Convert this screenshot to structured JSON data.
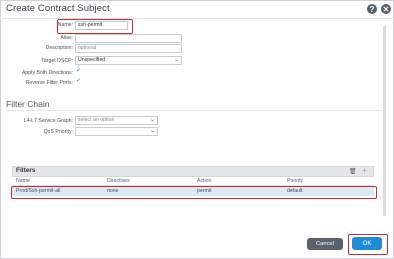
{
  "dialog": {
    "title": "Create Contract Subject",
    "help_icon": "help-icon",
    "close_icon": "close-icon"
  },
  "form": {
    "name_label": "Name:",
    "name_value": "ssh-permit",
    "alias_label": "Alias:",
    "alias_value": "",
    "description_label": "Description:",
    "description_value": "optional",
    "target_dscp_label": "Target DSCP:",
    "target_dscp_value": "Unspecified",
    "apply_both_label": "Apply Both Directions:",
    "apply_both_checked": true,
    "reverse_filter_label": "Reverse Filter Ports:",
    "reverse_filter_checked": true
  },
  "filter_chain": {
    "section_title": "Filter Chain",
    "l4l7_label": "L4-L7 Service Graph:",
    "l4l7_placeholder": "select an option",
    "qos_label": "QoS Priority:",
    "qos_value": ""
  },
  "filters": {
    "title": "Filters",
    "delete_icon": "trash-icon",
    "add_icon": "plus-icon",
    "columns": [
      "Name",
      "Directives",
      "Action",
      "Priority"
    ],
    "rows": [
      {
        "name": "Prod/Ssh-permit-all",
        "directives": "none",
        "action": "permit",
        "priority": "default"
      }
    ]
  },
  "footer": {
    "cancel_label": "Cancel",
    "ok_label": "OK"
  },
  "colors": {
    "accent": "#1f8ad6",
    "highlight": "#cc2a2a",
    "row_selected": "#dbe9f5"
  }
}
